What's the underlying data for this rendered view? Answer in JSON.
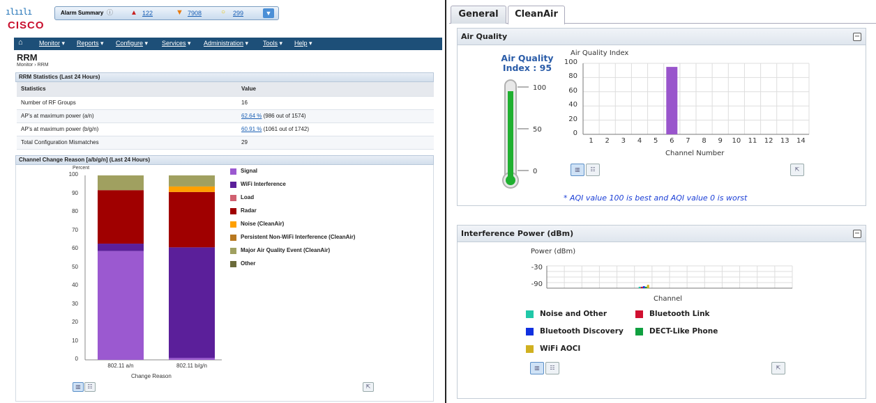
{
  "header": {
    "logo_bars": "ılıılı",
    "logo_word": "CISCO",
    "alarm_summary_label": "Alarm Summary",
    "alarm_critical": "122",
    "alarm_major": "7908",
    "alarm_minor": "299"
  },
  "nav": [
    {
      "label": "Monitor"
    },
    {
      "label": "Reports"
    },
    {
      "label": "Configure"
    },
    {
      "label": "Services"
    },
    {
      "label": "Administration"
    },
    {
      "label": "Tools"
    },
    {
      "label": "Help"
    }
  ],
  "page": {
    "title": "RRM",
    "breadcrumb_root": "Monitor",
    "breadcrumb_sep": "›",
    "breadcrumb_current": "RRM"
  },
  "stats": {
    "title": "RRM Statistics (Last 24 Hours)",
    "col_statistics": "Statistics",
    "col_value": "Value",
    "rows": [
      {
        "label": "Number of RF Groups",
        "link": "",
        "value": "16"
      },
      {
        "label": "AP's at maximum power (a/n)",
        "link": "62.64 %",
        "value": "(986 out of 1574)"
      },
      {
        "label": "AP's at maximum power (b/g/n)",
        "link": "60.91 %",
        "value": "(1061 out of 1742)"
      },
      {
        "label": "Total Configuration Mismatches",
        "link": "",
        "value": "29"
      }
    ]
  },
  "channel_change": {
    "title": "Channel Change Reason [a/b/g/n] (Last 24 Hours)",
    "ylabel": "Percent",
    "xlabel": "Change Reason",
    "legend": [
      {
        "label": "Signal",
        "color": "#9b59d0"
      },
      {
        "label": "WiFi Interference",
        "color": "#5b1f9a"
      },
      {
        "label": "Load",
        "color": "#d06070"
      },
      {
        "label": "Radar",
        "color": "#a00000"
      },
      {
        "label": "Noise (CleanAir)",
        "color": "#ffa000"
      },
      {
        "label": "Persistent Non-WiFi Interference (CleanAir)",
        "color": "#b87820"
      },
      {
        "label": "Major Air Quality Event (CleanAir)",
        "color": "#a0a060"
      },
      {
        "label": "Other",
        "color": "#6b6b3a"
      }
    ]
  },
  "tabs": {
    "general": "General",
    "cleanair": "CleanAir"
  },
  "air_quality": {
    "panel_title": "Air Quality",
    "gauge_title_line1": "Air Quality",
    "gauge_title_line2": "Index : 95",
    "gauge_value": 95,
    "gauge_ticks": [
      "100",
      "50",
      "0"
    ],
    "chart_title": "Air Quality Index",
    "xlabel": "Channel Number",
    "note": "* AQI value 100 is best and AQI value 0 is worst"
  },
  "interference": {
    "panel_title": "Interference Power (dBm)",
    "ylabel": "Power (dBm)",
    "xlabel": "Channel",
    "legend": [
      {
        "label": "Noise and Other",
        "color": "#20c8a8"
      },
      {
        "label": "Bluetooth Link",
        "color": "#d01030"
      },
      {
        "label": "Bluetooth Discovery",
        "color": "#1030e0"
      },
      {
        "label": "DECT-Like Phone",
        "color": "#10a040"
      },
      {
        "label": "WiFi AOCI",
        "color": "#d0b020"
      }
    ]
  },
  "chart_data": [
    {
      "type": "bar",
      "title": "Channel Change Reason [a/b/g/n] (Last 24 Hours)",
      "ylabel": "Percent",
      "xlabel": "Change Reason",
      "ylim": [
        0,
        100
      ],
      "yticks": [
        "100",
        "90",
        "80",
        "70",
        "60",
        "50",
        "40",
        "30",
        "20",
        "10",
        "0"
      ],
      "categories": [
        "802.11 a/n",
        "802.11 b/g/n"
      ],
      "stacked": true,
      "series": [
        {
          "name": "Signal",
          "values": [
            59,
            1
          ]
        },
        {
          "name": "WiFi Interference",
          "values": [
            4,
            60
          ]
        },
        {
          "name": "Load",
          "values": [
            0,
            0
          ]
        },
        {
          "name": "Radar",
          "values": [
            29,
            30
          ]
        },
        {
          "name": "Noise (CleanAir)",
          "values": [
            0,
            3
          ]
        },
        {
          "name": "Persistent Non-WiFi Interference (CleanAir)",
          "values": [
            0,
            0
          ]
        },
        {
          "name": "Major Air Quality Event (CleanAir)",
          "values": [
            8,
            6
          ]
        },
        {
          "name": "Other",
          "values": [
            0,
            0
          ]
        }
      ],
      "colors": [
        "#9b59d0",
        "#5b1f9a",
        "#d06070",
        "#a00000",
        "#ffa000",
        "#b87820",
        "#a0a060",
        "#6b6b3a"
      ],
      "grid": false,
      "legend": "right"
    },
    {
      "type": "bar",
      "title": "Air Quality Index",
      "xlabel": "Channel Number",
      "ylim": [
        0,
        100
      ],
      "yticks": [
        "100",
        "80",
        "60",
        "40",
        "20",
        "0"
      ],
      "categories": [
        "1",
        "2",
        "3",
        "4",
        "5",
        "6",
        "7",
        "8",
        "9",
        "10",
        "11",
        "12",
        "13",
        "14"
      ],
      "values": [
        null,
        null,
        null,
        null,
        null,
        95,
        null,
        null,
        null,
        null,
        null,
        null,
        null,
        null
      ],
      "color": "#9955cc",
      "grid": true
    },
    {
      "type": "bar",
      "xlabel": "Channel",
      "ylabel": "Power (dBm)",
      "yticks": [
        "-30",
        "-90"
      ],
      "channel": 6,
      "series": [
        {
          "name": "Noise and Other",
          "values": [
            -95
          ]
        },
        {
          "name": "Bluetooth Link",
          "values": [
            -95
          ]
        },
        {
          "name": "Bluetooth Discovery",
          "values": [
            -93
          ]
        },
        {
          "name": "DECT-Like Phone",
          "values": [
            -95
          ]
        },
        {
          "name": "WiFi AOCI",
          "values": [
            -88
          ]
        }
      ],
      "grid": true,
      "legend": "bottom"
    }
  ]
}
